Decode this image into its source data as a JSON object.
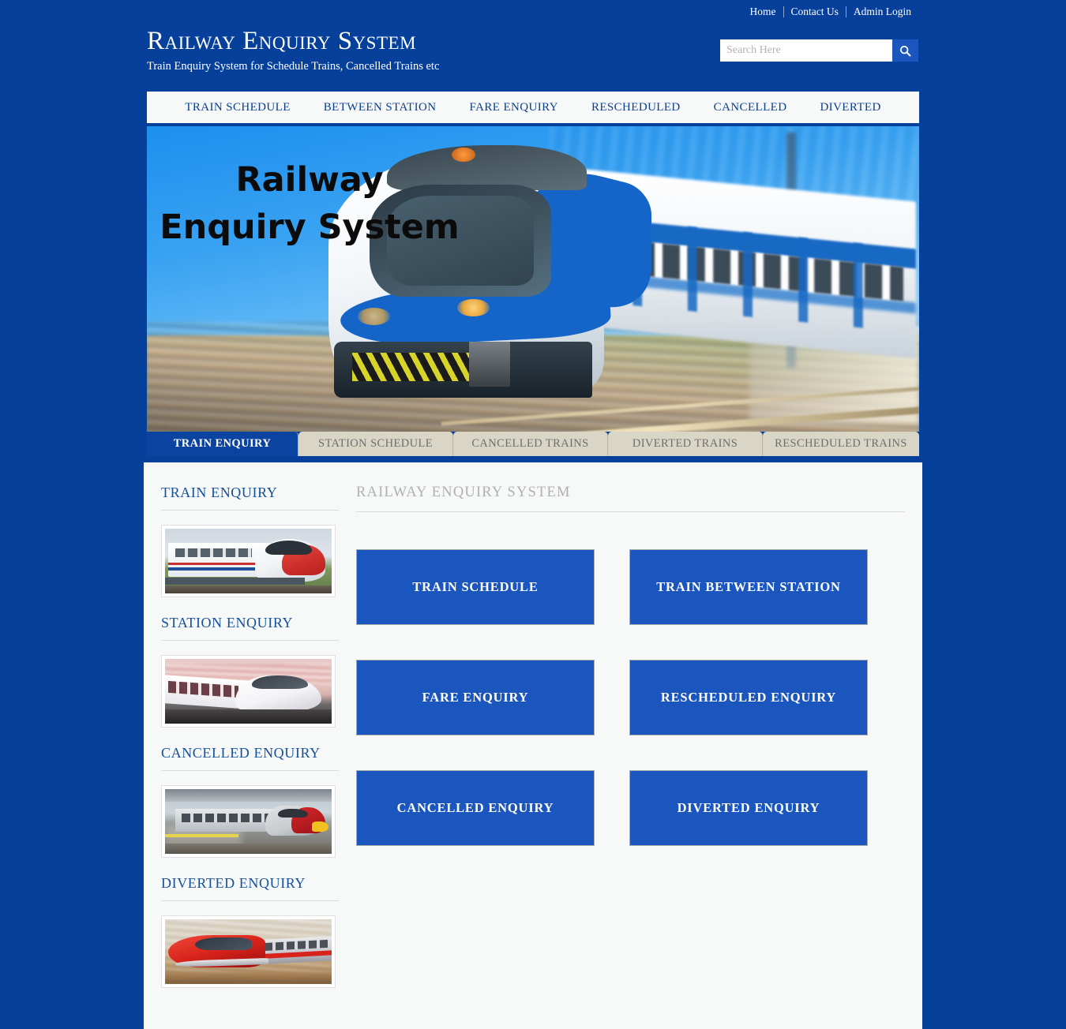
{
  "colors": {
    "page_background": "#06409B",
    "panel_background": "#F7F8F8",
    "accent_blue": "#1B56BF",
    "active_tab_blue": "#0B44A0",
    "inactive_tab_beige": "#DAD6C6",
    "heading_blue": "#14509C",
    "muted_gray": "#B0B0B0"
  },
  "topbar": {
    "links": [
      {
        "label": "Home"
      },
      {
        "label": "Contact Us"
      },
      {
        "label": "Admin Login"
      }
    ]
  },
  "header": {
    "title": "Railway Enquiry System",
    "subtitle": "Train Enquiry System for Schedule Trains, Cancelled Trains etc",
    "search": {
      "placeholder": "Search Here",
      "value": "",
      "button_icon": "search-icon"
    }
  },
  "nav": {
    "items": [
      {
        "label": "TRAIN SCHEDULE"
      },
      {
        "label": "BETWEEN STATION"
      },
      {
        "label": "FARE ENQUIRY"
      },
      {
        "label": "RESCHEDULED"
      },
      {
        "label": "CANCELLED"
      },
      {
        "label": "DIVERTED"
      }
    ]
  },
  "hero": {
    "overlay_title": "Railway Enquiry System",
    "image_description": "White and blue commuter train speeding past a platform with motion blur"
  },
  "tabs": {
    "items": [
      {
        "label": "TRAIN ENQUIRY",
        "active": true
      },
      {
        "label": "STATION SCHEDULE",
        "active": false
      },
      {
        "label": "CANCELLED TRAINS",
        "active": false
      },
      {
        "label": "DIVERTED TRAINS",
        "active": false
      },
      {
        "label": "RESCHEDULED TRAINS",
        "active": false
      }
    ]
  },
  "sidebar": {
    "sections": [
      {
        "heading": "TRAIN ENQUIRY",
        "image_description": "White high-speed train with red nose on a green landscape"
      },
      {
        "heading": "STATION ENQUIRY",
        "image_description": "White bullet train under a pink sunset sky"
      },
      {
        "heading": "CANCELLED ENQUIRY",
        "image_description": "Red and silver Virgin train at a station platform"
      },
      {
        "heading": "DIVERTED ENQUIRY",
        "image_description": "Red high-speed train in motion blur"
      }
    ]
  },
  "main": {
    "heading": "RAILWAY ENQUIRY SYSTEM",
    "buttons": [
      {
        "label": "TRAIN SCHEDULE"
      },
      {
        "label": "TRAIN BETWEEN STATION"
      },
      {
        "label": "FARE ENQUIRY"
      },
      {
        "label": "RESCHEDULED ENQUIRY"
      },
      {
        "label": "CANCELLED ENQUIRY"
      },
      {
        "label": "DIVERTED ENQUIRY"
      }
    ]
  }
}
